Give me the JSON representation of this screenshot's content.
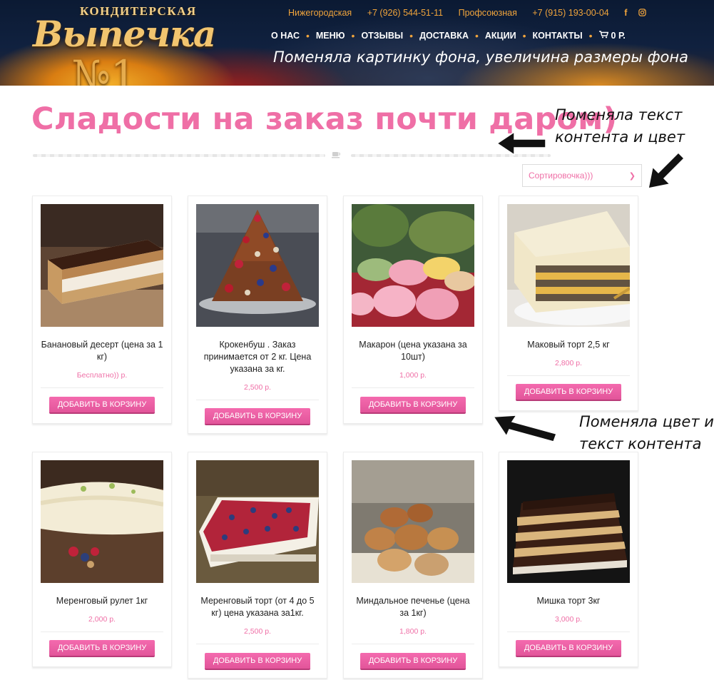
{
  "header": {
    "logo_top": "КОНДИТЕРСКАЯ",
    "logo_script": "Выпечка",
    "logo_number": "№1",
    "topbar": {
      "address1": "Нижегородская",
      "phone1": "+7 (926) 544-51-11",
      "address2": "Профсоюзная",
      "phone2": "+7 (915) 193-00-04",
      "icons": [
        "facebook-icon",
        "instagram-icon"
      ]
    },
    "nav": [
      "О НАС",
      "МЕНЮ",
      "ОТЗЫВЫ",
      "ДОСТАВКА",
      "АКЦИИ",
      "КОНТАКТЫ"
    ],
    "cart": "0 Р."
  },
  "notes": {
    "header": "Поменяла картинку фона, увеличина размеры фона",
    "title_line1": "Поменяла текст",
    "title_line2": "контента и цвет",
    "cards_line1": "Поменяла цвет и",
    "cards_line2": "текст контента"
  },
  "main": {
    "title": "Сладости на заказ почти даром)",
    "sort_value": "Сортировочка)))",
    "add_to_cart": "ДОБАВИТЬ В КОРЗИНУ"
  },
  "products": [
    {
      "name": "Банановый десерт (цена за 1 кг)",
      "price": "Бесплатно)) р."
    },
    {
      "name": "Крокенбуш . Заказ принимается от 2 кг. Цена указана за кг.",
      "price": "2,500  р."
    },
    {
      "name": "Макарон (цена указана за 10шт)",
      "price": "1,000  р."
    },
    {
      "name": "Маковый торт 2,5 кг",
      "price": "2,800  р."
    },
    {
      "name": "Меренговый рулет 1кг",
      "price": "2,000  р."
    },
    {
      "name": "Меренговый торт (от 4 до 5 кг) цена указана за1кг.",
      "price": "2,500  р."
    },
    {
      "name": "Миндальное печенье (цена за 1кг)",
      "price": "1,800  р."
    },
    {
      "name": "Мишка торт 3кг",
      "price": "3,000  р."
    }
  ],
  "colors": {
    "accent_pink": "#ef6fa6",
    "button_pink": "#e95fa3",
    "topbar_orange": "#f0a43c",
    "header_dark": "#0f1f3c"
  }
}
